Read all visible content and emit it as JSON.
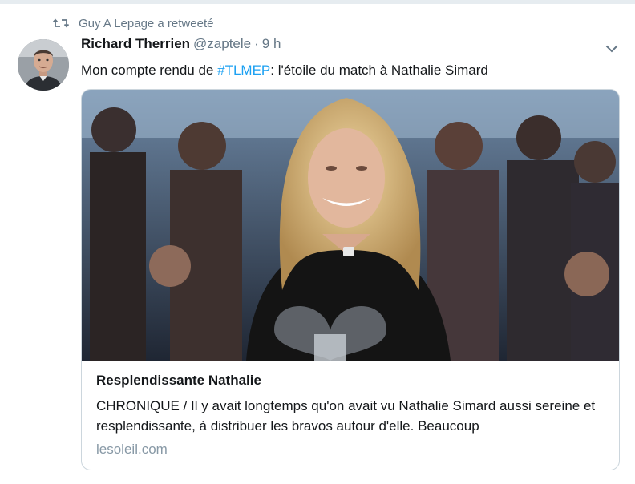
{
  "retweet": {
    "icon": "retweet-icon",
    "text": "Guy A Lepage a retweeté"
  },
  "tweet": {
    "author_name": "Richard Therrien",
    "handle": "@zaptele",
    "separator": "·",
    "time": "9 h",
    "text_before": "Mon compte rendu de ",
    "hashtag": "#TLMEP",
    "text_after": ": l'étoile du match à Nathalie Simard",
    "menu_icon": "chevron-down-icon"
  },
  "card": {
    "title": "Resplendissante Nathalie",
    "description": "CHRONIQUE / Il y avait longtemps qu'on avait vu Nathalie Simard aussi sereine et resplendissante, à distribuer les bravos autour d'elle. Beaucoup",
    "domain": "lesoleil.com"
  },
  "colors": {
    "link": "#1da1f2",
    "secondary_text": "#657786",
    "border": "#ccd6dd"
  }
}
